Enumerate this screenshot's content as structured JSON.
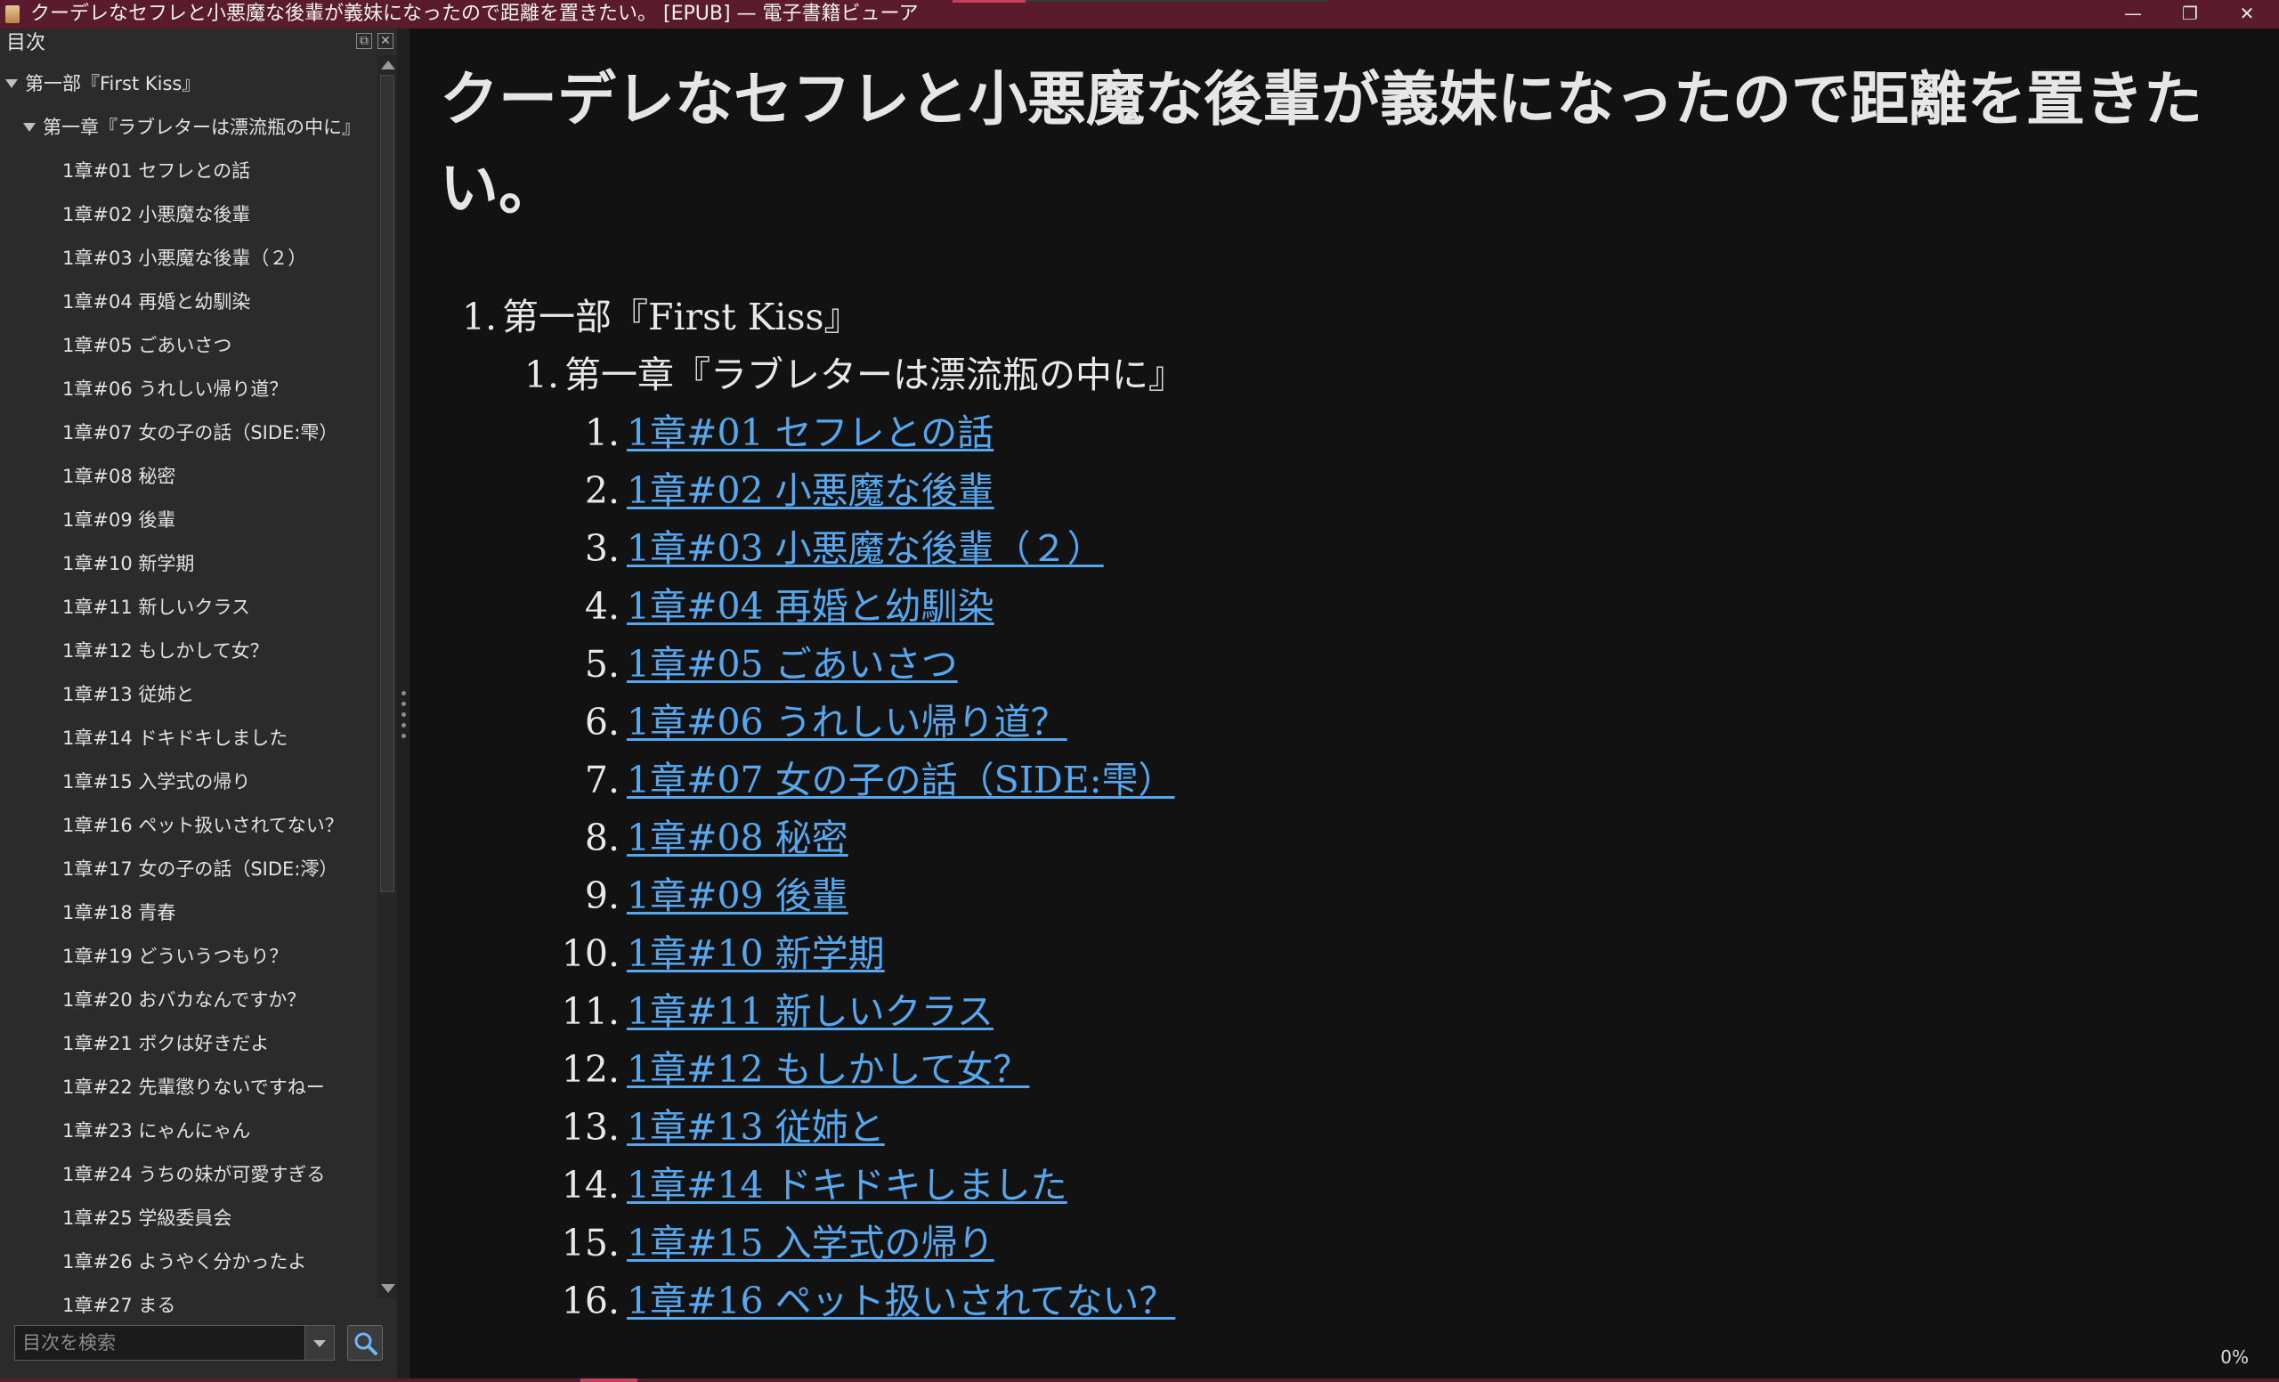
{
  "window": {
    "title": "クーデレなセフレと小悪魔な後輩が義妹になったので距離を置きたい。 [EPUB] — 電子書籍ビューア",
    "minimize": "—",
    "restore": "❐",
    "close": "✕"
  },
  "sidebar": {
    "header": "目次",
    "float_icon": "float-icon",
    "close_icon": "close-icon",
    "items": [
      {
        "label": "第一部『First Kiss』"
      },
      {
        "label": "第一章『ラブレターは漂流瓶の中に』"
      },
      {
        "label": "1章#01 セフレとの話"
      },
      {
        "label": "1章#02 小悪魔な後輩"
      },
      {
        "label": "1章#03 小悪魔な後輩（２）"
      },
      {
        "label": "1章#04 再婚と幼馴染"
      },
      {
        "label": "1章#05 ごあいさつ"
      },
      {
        "label": "1章#06 うれしい帰り道？"
      },
      {
        "label": "1章#07 女の子の話（SIDE:雫）"
      },
      {
        "label": "1章#08 秘密"
      },
      {
        "label": "1章#09 後輩"
      },
      {
        "label": "1章#10 新学期"
      },
      {
        "label": "1章#11 新しいクラス"
      },
      {
        "label": "1章#12 もしかして女？"
      },
      {
        "label": "1章#13 従姉と"
      },
      {
        "label": "1章#14 ドキドキしました"
      },
      {
        "label": "1章#15 入学式の帰り"
      },
      {
        "label": "1章#16 ペット扱いされてない？"
      },
      {
        "label": "1章#17 女の子の話（SIDE:澪）"
      },
      {
        "label": "1章#18 青春"
      },
      {
        "label": "1章#19 どういうつもり？"
      },
      {
        "label": "1章#20 おバカなんですか？"
      },
      {
        "label": "1章#21 ボクは好きだよ"
      },
      {
        "label": "1章#22 先輩懲りないですねー"
      },
      {
        "label": "1章#23 にゃんにゃん"
      },
      {
        "label": "1章#24 うちの妹が可愛すぎる"
      },
      {
        "label": "1章#25 学級委員会"
      },
      {
        "label": "1章#26 ようやく分かったよ"
      },
      {
        "label": "1章#27 まる"
      }
    ],
    "search_placeholder": "目次を検索",
    "search_icon": "search-icon"
  },
  "reader": {
    "book_title": "クーデレなセフレと小悪魔な後輩が義妹になったので距離を置きたい。",
    "part": {
      "num": "1.",
      "label": "第一部『First Kiss』"
    },
    "chapter": {
      "num": "1.",
      "label": "第一章『ラブレターは漂流瓶の中に』"
    },
    "links": [
      {
        "num": "1.",
        "label": "1章#01 セフレとの話"
      },
      {
        "num": "2.",
        "label": "1章#02 小悪魔な後輩"
      },
      {
        "num": "3.",
        "label": "1章#03 小悪魔な後輩（２）"
      },
      {
        "num": "4.",
        "label": "1章#04 再婚と幼馴染"
      },
      {
        "num": "5.",
        "label": "1章#05 ごあいさつ"
      },
      {
        "num": "6.",
        "label": "1章#06 うれしい帰り道？"
      },
      {
        "num": "7.",
        "label": "1章#07 女の子の話（SIDE:雫）"
      },
      {
        "num": "8.",
        "label": "1章#08 秘密"
      },
      {
        "num": "9.",
        "label": "1章#09 後輩"
      },
      {
        "num": "10.",
        "label": "1章#10 新学期"
      },
      {
        "num": "11.",
        "label": "1章#11 新しいクラス"
      },
      {
        "num": "12.",
        "label": "1章#12 もしかして女？"
      },
      {
        "num": "13.",
        "label": "1章#13 従姉と"
      },
      {
        "num": "14.",
        "label": "1章#14 ドキドキしました"
      },
      {
        "num": "15.",
        "label": "1章#15 入学式の帰り"
      },
      {
        "num": "16.",
        "label": "1章#16 ペット扱いされてない？"
      }
    ],
    "progress": "0%"
  },
  "colors": {
    "titlebar": "#5a1b2c",
    "link": "#57a7ef",
    "sidebar_bg": "#2b2b2b",
    "reader_bg": "#121212"
  }
}
